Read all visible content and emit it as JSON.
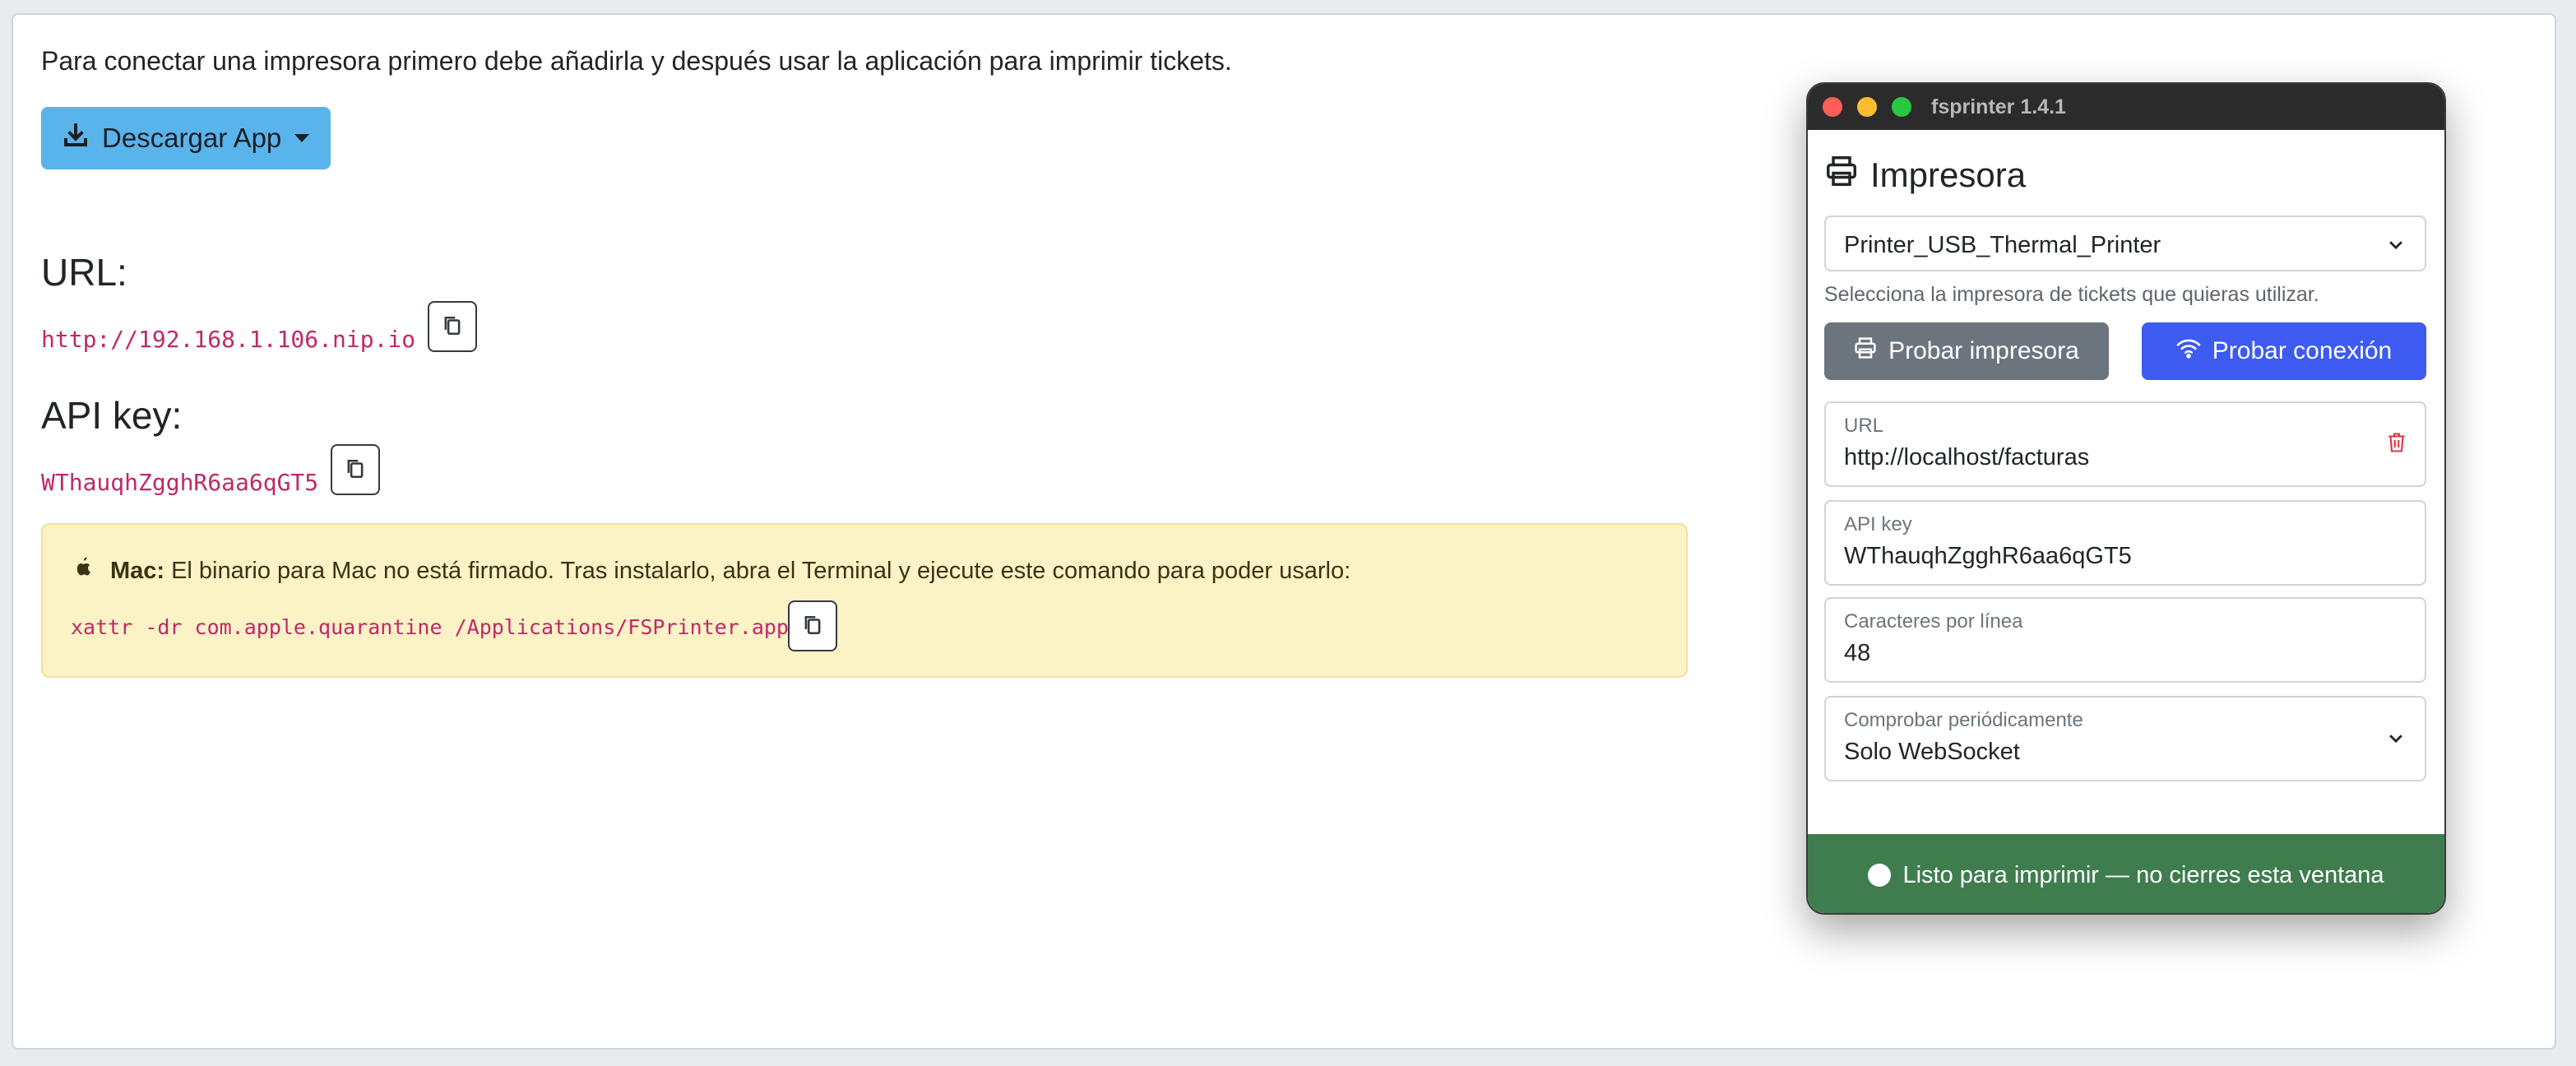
{
  "intro": "Para conectar una impresora primero debe añadirla y después usar la aplicación para imprimir tickets.",
  "download": {
    "label": "Descargar App"
  },
  "url_section": {
    "title": "URL:",
    "value": "http://192.168.1.106.nip.io"
  },
  "apikey_section": {
    "title": "API key:",
    "value": "WThauqhZgghR6aa6qGT5"
  },
  "alert": {
    "bold": "Mac:",
    "text": "El binario para Mac no está firmado. Tras instalarlo, abra el Terminal y ejecute este comando para poder usarlo:",
    "command": "xattr -dr com.apple.quarantine /Applications/FSPrinter.app"
  },
  "window": {
    "title": "fsprinter 1.4.1",
    "section_title": "Impresora",
    "printer_select": "Printer_USB_Thermal_Printer",
    "help": "Selecciona la impresora de tickets que quieras utilizar.",
    "test_printer": "Probar impresora",
    "test_connection": "Probar conexión",
    "fields": {
      "url": {
        "label": "URL",
        "value": "http://localhost/facturas"
      },
      "apikey": {
        "label": "API key",
        "value": "WThauqhZgghR6aa6qGT5"
      },
      "chars": {
        "label": "Caracteres por línea",
        "value": "48"
      },
      "check": {
        "label": "Comprobar periódicamente",
        "value": "Solo WebSocket"
      }
    },
    "status": "Listo para imprimir — no cierres esta ventana"
  },
  "colors": {
    "download_btn": "#5ab4ec",
    "code": "#c0286a",
    "alert_bg": "#fbf2c6",
    "btn_gray": "#6c757d",
    "btn_blue": "#3d5af1",
    "status_green": "#3f7d4f",
    "traffic_red": "#ff5f57",
    "traffic_yellow": "#febc2e",
    "traffic_green": "#28c840"
  },
  "icons": [
    "download-icon",
    "copy-icon",
    "apple-icon",
    "printer-icon",
    "wifi-icon",
    "chevron-down-icon",
    "trash-icon"
  ]
}
